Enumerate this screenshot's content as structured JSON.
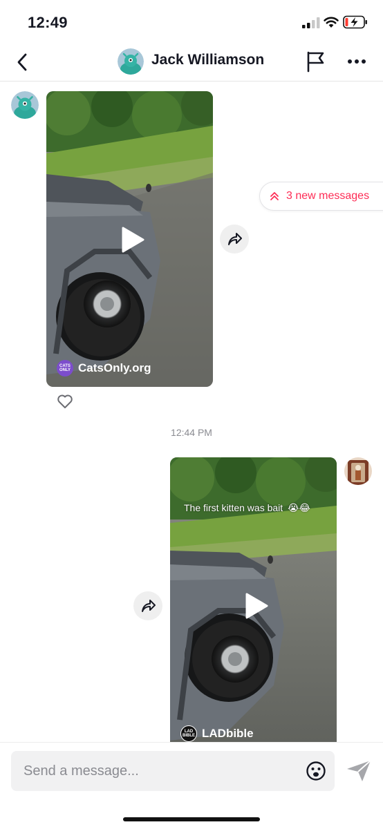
{
  "status_bar": {
    "time": "12:49"
  },
  "header": {
    "contact_name": "Jack Williamson"
  },
  "new_messages_pill": {
    "label": "3 new messages"
  },
  "messages": [
    {
      "direction": "incoming",
      "source_name": "CatsOnly.org",
      "source_logo_text": "CATS ONLY",
      "caption": ""
    },
    {
      "direction": "outgoing",
      "source_name": "LADbible",
      "source_logo_text": "LAD BIBLE",
      "caption": "The first kitten was bait 😭😂"
    }
  ],
  "timestamp": "12:44 PM",
  "composer": {
    "placeholder": "Send a message..."
  },
  "colors": {
    "accent": "#fe2c55",
    "text": "#161823",
    "muted": "#8a8b91"
  }
}
